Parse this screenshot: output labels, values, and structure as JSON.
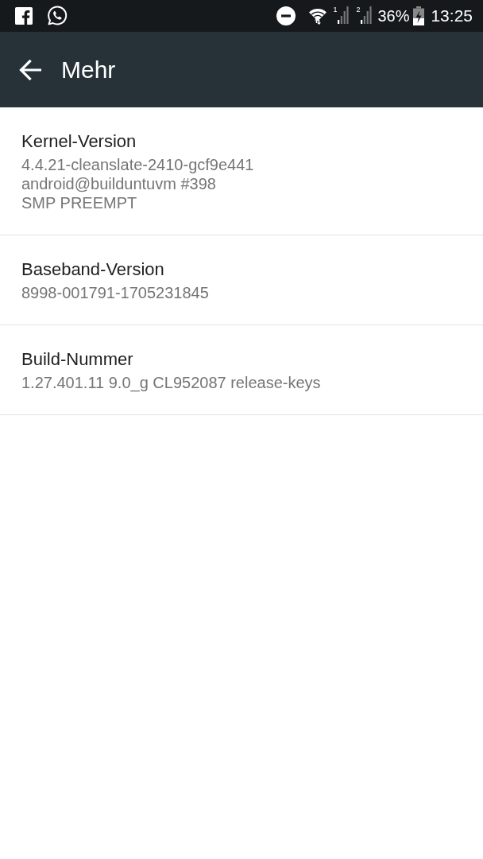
{
  "status_bar": {
    "sim_slots": [
      "1",
      "2"
    ],
    "battery_percent": "36%",
    "time": "13:25"
  },
  "app_bar": {
    "title": "Mehr"
  },
  "items": [
    {
      "title": "Kernel-Version",
      "summary": "4.4.21-cleanslate-2410-gcf9e441\nandroid@builduntuvm #398\nSMP PREEMPT"
    },
    {
      "title": "Baseband-Version",
      "summary": "8998-001791-1705231845"
    },
    {
      "title": "Build-Nummer",
      "summary": "1.27.401.11 9.0_g CL952087 release-keys"
    }
  ]
}
